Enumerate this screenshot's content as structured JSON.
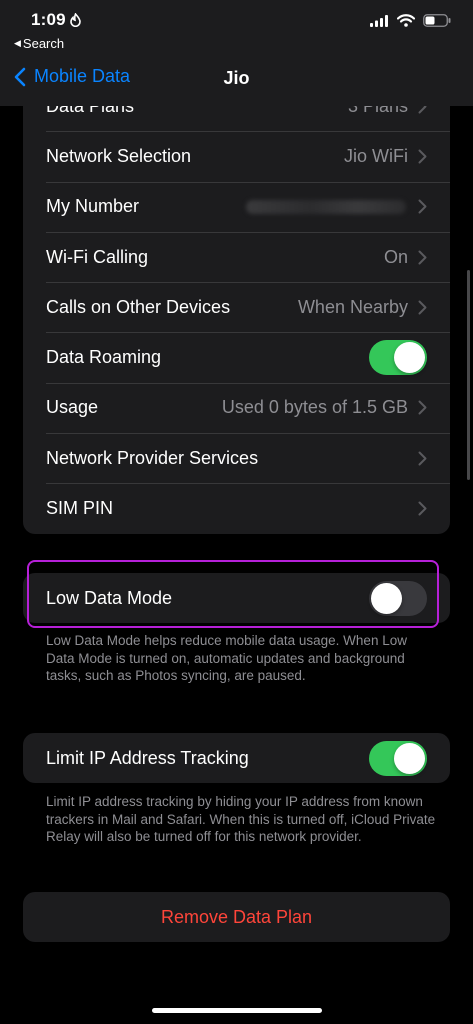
{
  "status_bar": {
    "time": "1:09",
    "back_app": "Search"
  },
  "nav": {
    "back_label": "Mobile Data",
    "title": "Jio"
  },
  "carrier_settings": [
    {
      "label": "Data Plans",
      "value": "3 Plans"
    },
    {
      "label": "Network Selection",
      "value": "Jio WiFi"
    },
    {
      "label": "My Number",
      "value": ""
    },
    {
      "label": "Wi-Fi Calling",
      "value": "On"
    },
    {
      "label": "Calls on Other Devices",
      "value": "When Nearby"
    },
    {
      "label": "Data Roaming",
      "toggle": true
    },
    {
      "label": "Usage",
      "value": "Used 0 bytes of 1.5 GB"
    },
    {
      "label": "Network Provider Services",
      "value": ""
    },
    {
      "label": "SIM PIN",
      "value": ""
    }
  ],
  "low_data_mode": {
    "label": "Low Data Mode",
    "enabled": false,
    "footnote": "Low Data Mode helps reduce mobile data usage. When Low Data Mode is turned on, automatic updates and background tasks, such as Photos syncing, are paused."
  },
  "limit_ip_tracking": {
    "label": "Limit IP Address Tracking",
    "enabled": true,
    "footnote": "Limit IP address tracking by hiding your IP address from known trackers in Mail and Safari. When this is turned off, iCloud Private Relay will also be turned off for this network provider."
  },
  "remove_button": "Remove Data Plan",
  "colors": {
    "accent": "#0a84ff",
    "toggle_on": "#34c759",
    "destructive": "#ff453a",
    "highlight": "#b620d8"
  }
}
